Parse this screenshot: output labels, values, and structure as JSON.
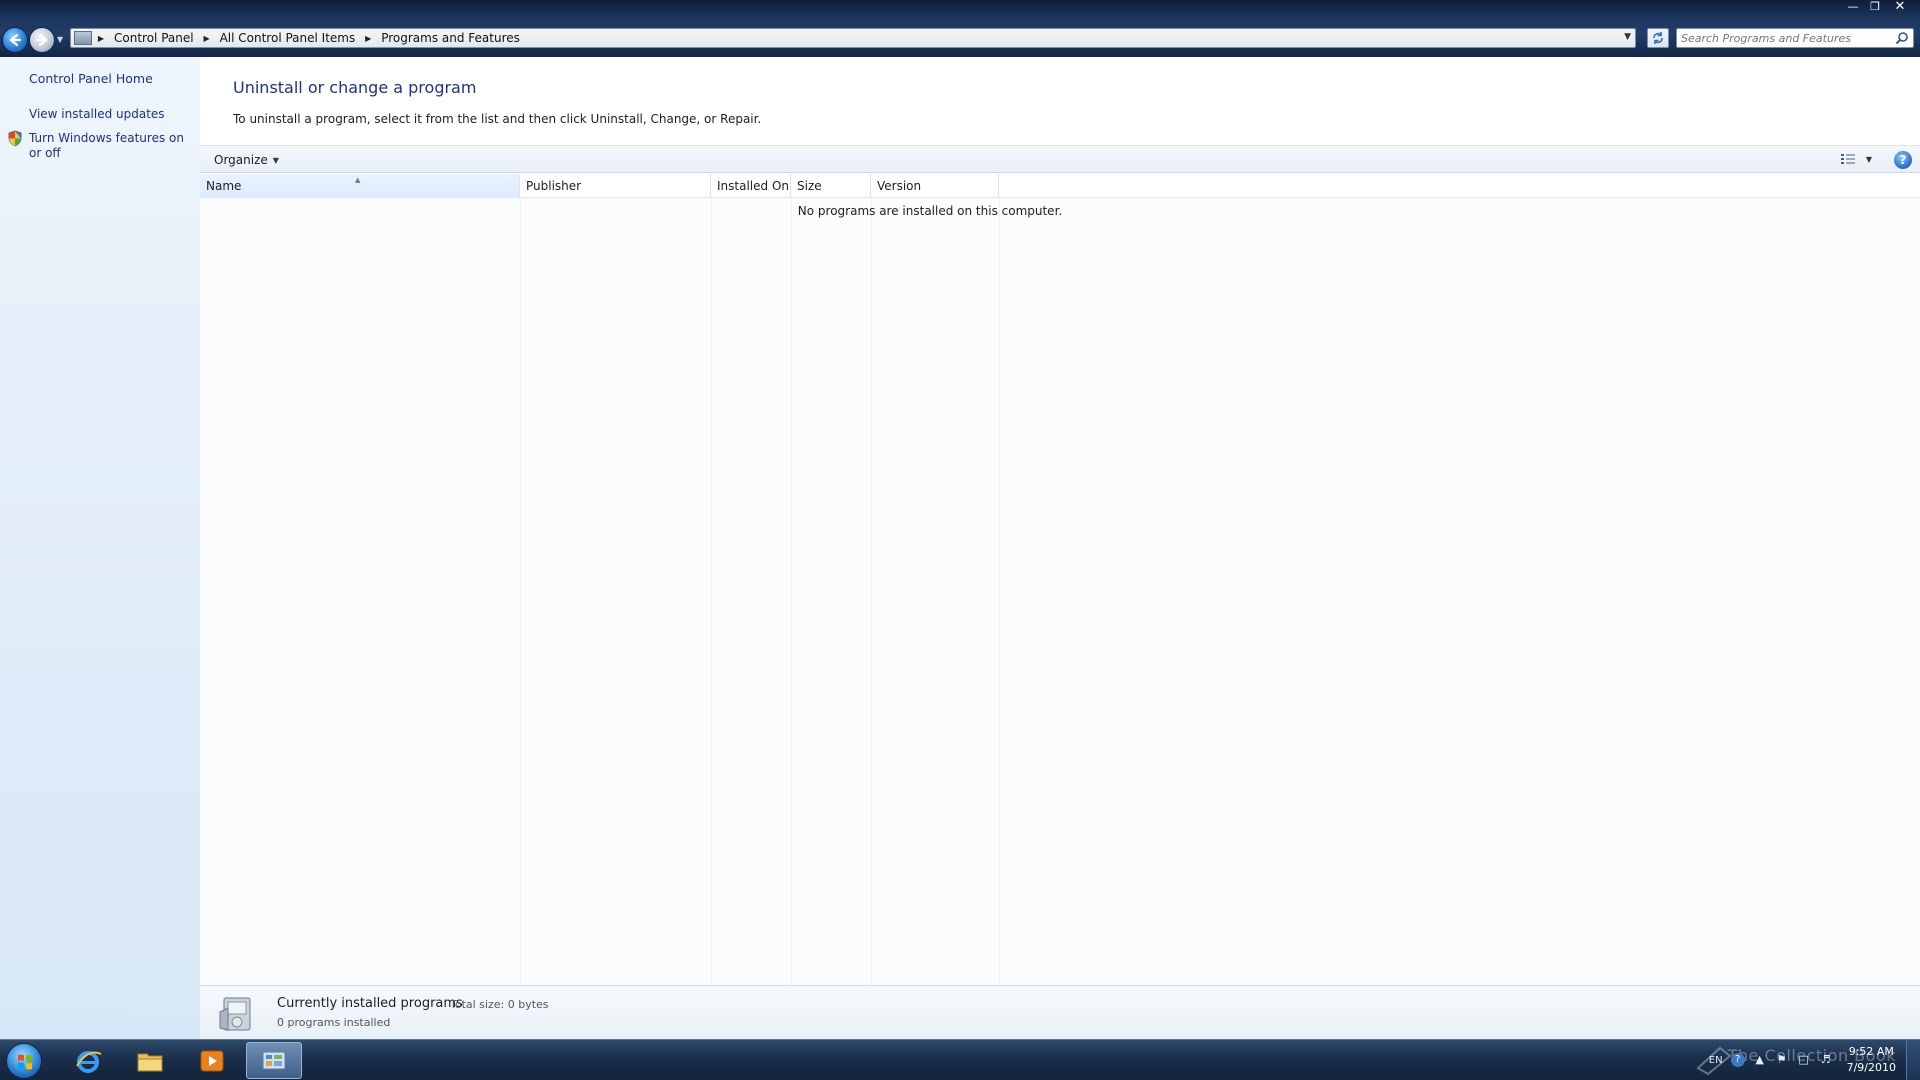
{
  "window": {
    "minimize_icon": "minimize-icon",
    "maximize_icon": "maximize-icon",
    "close_icon": "close-icon"
  },
  "navigation": {
    "breadcrumbs": [
      "Control Panel",
      "All Control Panel Items",
      "Programs and Features"
    ],
    "search_placeholder": "Search Programs and Features"
  },
  "sidebar": {
    "items": [
      {
        "label": "Control Panel Home"
      },
      {
        "label": "View installed updates"
      },
      {
        "label": "Turn Windows features on or off",
        "icon": "shield-icon"
      }
    ]
  },
  "main": {
    "title": "Uninstall or change a program",
    "description": "To uninstall a program, select it from the list and then click Uninstall, Change, or Repair.",
    "toolbar": {
      "organize_label": "Organize",
      "help_label": "?"
    },
    "columns": [
      "Name",
      "Publisher",
      "Installed On",
      "Size",
      "Version"
    ],
    "sorted_column": "Name",
    "empty_message": "No programs are installed on this computer.",
    "details": {
      "title": "Currently installed programs",
      "total_size": "Total size: 0 bytes",
      "count": "0 programs installed"
    }
  },
  "taskbar": {
    "language": "EN",
    "time": "9:52 AM",
    "date": "7/9/2010",
    "watermark": "The Collection Book",
    "pinned": [
      "internet-explorer-icon",
      "windows-explorer-icon",
      "media-player-icon",
      "control-panel-icon"
    ]
  },
  "colors": {
    "link": "#1e3287",
    "titlebar": "#1c355e",
    "left_pane": "#e3eef9",
    "taskbar": "#1a2f4b"
  }
}
